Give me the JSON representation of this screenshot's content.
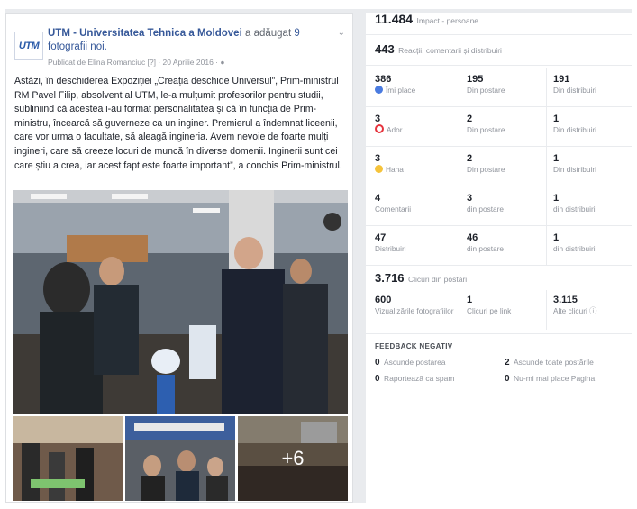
{
  "post": {
    "page_name": "UTM - Universitatea Tehnica a Moldovei",
    "action_text": " a adăugat ",
    "photo_count": "9 fotografii noi.",
    "meta": "Publicat de Elina Romanciuc [?] · 20 Aprilie 2016 · ",
    "logo_text": "UTM",
    "body": "Astăzi, în deschiderea Expoziției „Creația deschide Universul”, Prim-ministrul RM Pavel Filip, absolvent al UTM, le-a mulțumit profesorilor pentru studii, subliniind că acestea i-au format personalitatea și că în funcția de Prim-ministru, încearcă să guverneze ca un inginer. Premierul a îndemnat liceenii, care vor urma o facultate, să aleagă ingineria. Avem nevoie de foarte mulți ingineri, care să creeze locuri de muncă în diverse domenii. Inginerii sunt cei care știu a crea, iar acest fapt este foarte important”, a conchis Prim-ministrul.",
    "more_photos": "+6"
  },
  "stats": {
    "impact_value": "11.484",
    "impact_label": "Impact - persoane",
    "reactions_value": "443",
    "reactions_label": "Reacții, comentarii și distribuiri",
    "rows": [
      {
        "total": "386",
        "label": "Îmi place",
        "icon": "like-icon",
        "post_val": "195",
        "post_label": "Din postare",
        "share_val": "191",
        "share_label": "Din distribuiri"
      },
      {
        "total": "3",
        "label": "Ador",
        "icon": "love-icon",
        "post_val": "2",
        "post_label": "Din postare",
        "share_val": "1",
        "share_label": "Din distribuiri"
      },
      {
        "total": "3",
        "label": "Haha",
        "icon": "haha-icon",
        "post_val": "2",
        "post_label": "Din postare",
        "share_val": "1",
        "share_label": "Din distribuiri"
      },
      {
        "total": "4",
        "label": "Comentarii",
        "icon": "",
        "post_val": "3",
        "post_label": "din postare",
        "share_val": "1",
        "share_label": "din distribuiri"
      },
      {
        "total": "47",
        "label": "Distribuiri",
        "icon": "",
        "post_val": "46",
        "post_label": "din postare",
        "share_val": "1",
        "share_label": "din distribuiri"
      }
    ],
    "clicks_value": "3.716",
    "clicks_label": "Clicuri din postări",
    "clicks": [
      {
        "value": "600",
        "label": "Vizualizările fotografiilor"
      },
      {
        "value": "1",
        "label": "Clicuri pe link"
      },
      {
        "value": "3.115",
        "label": "Alte clicuri ⓘ"
      }
    ],
    "negative_title": "FEEDBACK NEGATIV",
    "negative": [
      {
        "value": "0",
        "label": "Ascunde postarea"
      },
      {
        "value": "2",
        "label": "Ascunde toate postările"
      },
      {
        "value": "0",
        "label": "Raportează ca spam"
      },
      {
        "value": "0",
        "label": "Nu-mi mai place Pagina"
      }
    ]
  },
  "colors": {
    "link": "#365899",
    "like": "#4a7be0",
    "love": "#e6343e",
    "haha": "#f5c33b"
  }
}
